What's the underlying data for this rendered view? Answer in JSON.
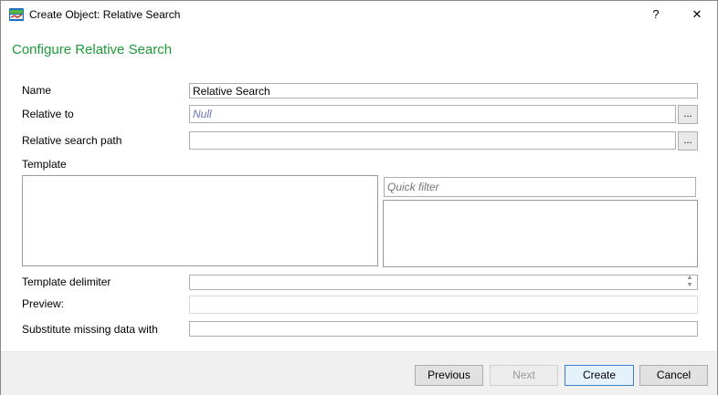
{
  "window": {
    "title": "Create Object: Relative Search",
    "help_label": "?",
    "close_label": "✕"
  },
  "heading": "Configure Relative Search",
  "form": {
    "name_label": "Name",
    "name_value": "Relative Search",
    "relative_to_label": "Relative to",
    "relative_to_value": "Null",
    "relative_search_path_label": "Relative search path",
    "relative_search_path_value": "",
    "template_label": "Template",
    "quick_filter_placeholder": "Quick filter",
    "template_delimiter_label": "Template delimiter",
    "template_delimiter_value": "",
    "preview_label": "Preview:",
    "preview_value": "",
    "substitute_label": "Substitute missing data with",
    "substitute_value": "",
    "browse_label": "..."
  },
  "buttons": {
    "previous": "Previous",
    "next": "Next",
    "create": "Create",
    "cancel": "Cancel"
  }
}
